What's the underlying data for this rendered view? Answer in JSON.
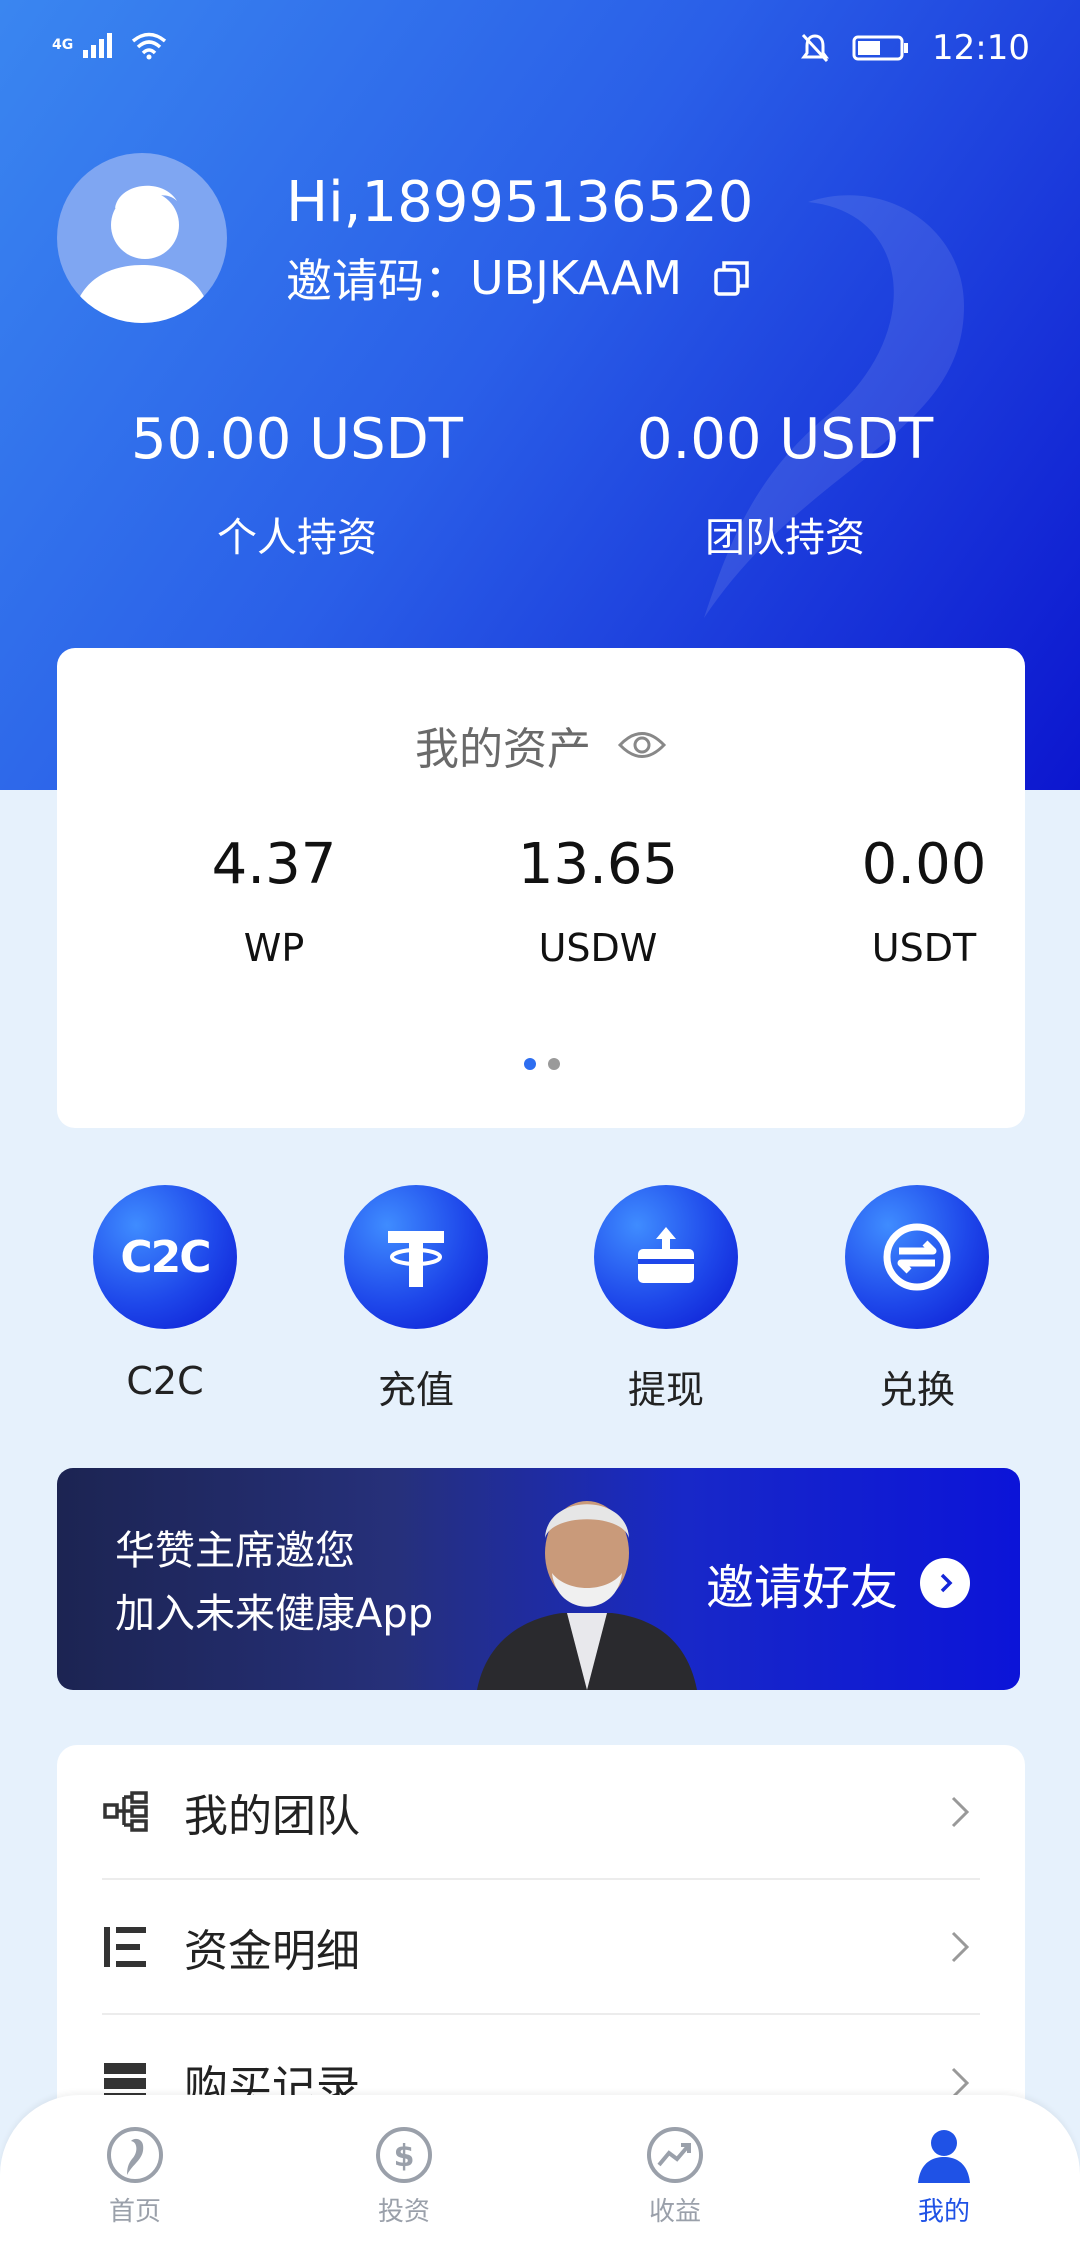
{
  "status_bar": {
    "network": "4G",
    "time": "12:10"
  },
  "profile": {
    "greeting": "Hi,18995136520",
    "invite_label": "邀请码：",
    "invite_code": "UBJKAAM"
  },
  "holdings": [
    {
      "amount": "50.00 USDT",
      "label": "个人持资"
    },
    {
      "amount": "0.00 USDT",
      "label": "团队持资"
    }
  ],
  "assets": {
    "title": "我的资产",
    "items": [
      {
        "value": "4.37",
        "unit": "WP"
      },
      {
        "value": "13.65",
        "unit": "USDW"
      },
      {
        "value": "0.00",
        "unit": "USDT"
      }
    ],
    "page_indicator": {
      "current": 1,
      "total": 2
    }
  },
  "actions": [
    {
      "label": "C2C",
      "icon": "c2c-icon",
      "icon_text": "C2C"
    },
    {
      "label": "充值",
      "icon": "tether-icon"
    },
    {
      "label": "提现",
      "icon": "withdraw-icon"
    },
    {
      "label": "兑换",
      "icon": "exchange-icon"
    }
  ],
  "banner": {
    "line1": "华赞主席邀您",
    "line2": "加入未来健康App",
    "cta": "邀请好友"
  },
  "menu": [
    {
      "label": "我的团队",
      "icon": "team-tree-icon"
    },
    {
      "label": "资金明细",
      "icon": "list-detail-icon"
    },
    {
      "label": "购买记录",
      "icon": "records-icon"
    }
  ],
  "nav": [
    {
      "label": "首页",
      "icon": "home-logo-icon",
      "active": false
    },
    {
      "label": "投资",
      "icon": "dollar-icon",
      "active": false
    },
    {
      "label": "收益",
      "icon": "trend-icon",
      "active": false
    },
    {
      "label": "我的",
      "icon": "user-icon",
      "active": true
    }
  ],
  "colors": {
    "primary": "#1f52e6",
    "gradient_start": "#3a86f0",
    "gradient_end": "#0c16cf",
    "page_bg": "#e6f1fc"
  }
}
